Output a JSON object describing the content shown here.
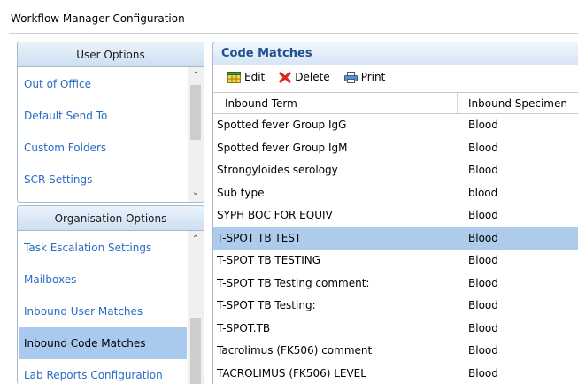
{
  "window": {
    "title": "Workflow Manager Configuration"
  },
  "user_options": {
    "header": "User Options",
    "items": [
      {
        "label": "Out of Office"
      },
      {
        "label": "Default Send To"
      },
      {
        "label": "Custom Folders"
      },
      {
        "label": "SCR Settings"
      }
    ]
  },
  "organisation_options": {
    "header": "Organisation Options",
    "selected_item": "Inbound Code Matches",
    "items": [
      {
        "label": "Task Escalation Settings"
      },
      {
        "label": "Mailboxes"
      },
      {
        "label": "Inbound User Matches"
      },
      {
        "label": "Inbound Code Matches"
      },
      {
        "label": "Lab Reports Configuration"
      }
    ]
  },
  "main": {
    "title": "Code Matches",
    "toolbar": {
      "edit_label": "Edit",
      "delete_label": "Delete",
      "print_label": "Print",
      "icons": [
        "grid-edit-icon",
        "red-x-delete-icon",
        "printer-icon"
      ]
    },
    "columns": [
      "Inbound Term",
      "Inbound Specimen"
    ],
    "selected_row": "T-SPOT TB TEST",
    "rows": [
      {
        "term": "Spotted fever Group IgG",
        "specimen": "Blood"
      },
      {
        "term": "Spotted fever Group IgM",
        "specimen": "Blood"
      },
      {
        "term": "Strongyloides serology",
        "specimen": "Blood"
      },
      {
        "term": "Sub type",
        "specimen": "blood"
      },
      {
        "term": "SYPH BOC FOR EQUIV",
        "specimen": "Blood"
      },
      {
        "term": "T-SPOT TB TEST",
        "specimen": "Blood"
      },
      {
        "term": "T-SPOT TB TESTING",
        "specimen": "Blood"
      },
      {
        "term": "T-SPOT TB Testing comment:",
        "specimen": "Blood"
      },
      {
        "term": "T-SPOT TB Testing:",
        "specimen": "Blood"
      },
      {
        "term": "T-SPOT.TB",
        "specimen": "Blood"
      },
      {
        "term": "Tacrolimus (FK506) comment",
        "specimen": "Blood"
      },
      {
        "term": "TACROLIMUS (FK506) LEVEL",
        "specimen": "Blood"
      }
    ]
  },
  "colors": {
    "link": "#2a6cc5",
    "selected_nav": "#a9c9ef",
    "selected_row": "#aecbeb",
    "header_title": "#1e4f8f"
  }
}
